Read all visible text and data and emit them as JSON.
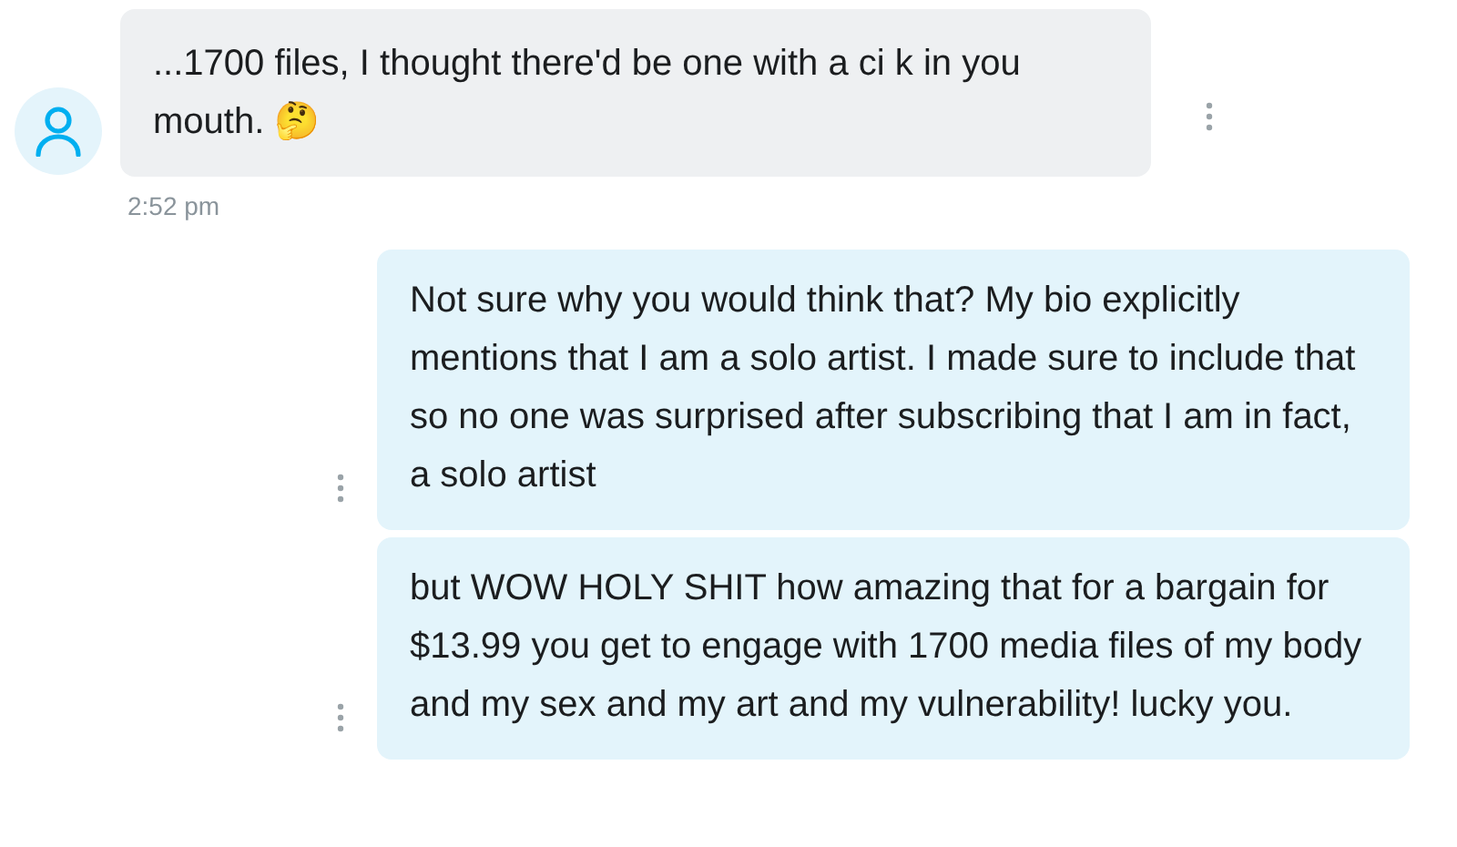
{
  "messages": [
    {
      "kind": "incoming",
      "text": "...1700 files, I thought there'd be one with a ci k in you mouth. 🤔",
      "time": "2:52 pm"
    },
    {
      "kind": "outgoing",
      "text": "Not sure why you would think that? My bio explicitly mentions that I am a solo artist. I made sure to include that so no one was surprised after subscribing that I am in fact, a solo artist"
    },
    {
      "kind": "outgoing",
      "text": "but WOW HOLY SHIT how amazing that for a bargain for $13.99 you get to engage with 1700 media files of my body and my sex and my art and my vulnerability! lucky you."
    }
  ]
}
